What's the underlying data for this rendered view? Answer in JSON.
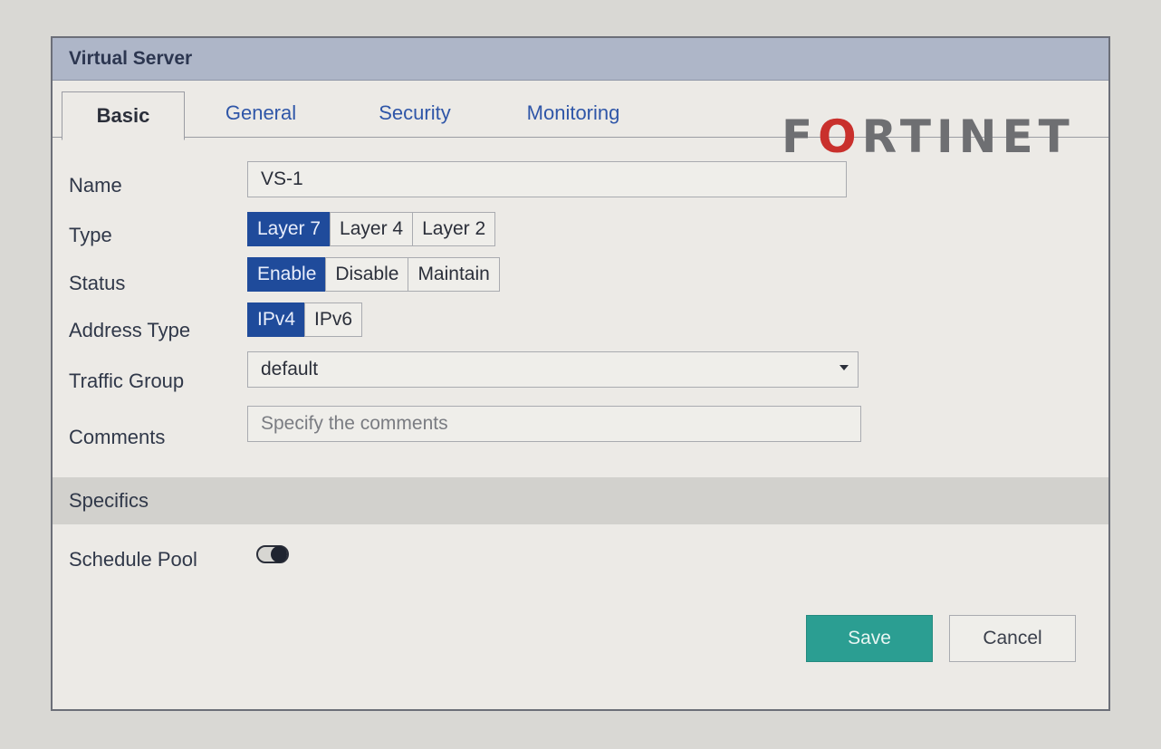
{
  "dialog": {
    "title": "Virtual Server"
  },
  "tabs": [
    {
      "label": "Basic",
      "active": true
    },
    {
      "label": "General"
    },
    {
      "label": "Security"
    },
    {
      "label": "Monitoring"
    }
  ],
  "logo": {
    "text_left": "F",
    "text_o": "O",
    "text_right": "RTINET"
  },
  "form": {
    "name": {
      "label": "Name",
      "value": "VS-1"
    },
    "type": {
      "label": "Type",
      "options": [
        "Layer 7",
        "Layer 4",
        "Layer 2"
      ],
      "selected": "Layer 7"
    },
    "status": {
      "label": "Status",
      "options": [
        "Enable",
        "Disable",
        "Maintain"
      ],
      "selected": "Enable"
    },
    "address_type": {
      "label": "Address Type",
      "options": [
        "IPv4",
        "IPv6"
      ],
      "selected": "IPv4"
    },
    "traffic_group": {
      "label": "Traffic Group",
      "value": "default"
    },
    "comments": {
      "label": "Comments",
      "placeholder": "Specify the comments"
    }
  },
  "specifics": {
    "title": "Specifics",
    "schedule_pool": {
      "label": "Schedule Pool",
      "enabled": false
    }
  },
  "actions": {
    "save": "Save",
    "cancel": "Cancel"
  },
  "colors": {
    "accent": "#1f4b9b",
    "save": "#2b9e92",
    "title_bar": "#aeb6c8",
    "logo_red": "#c9302c"
  }
}
